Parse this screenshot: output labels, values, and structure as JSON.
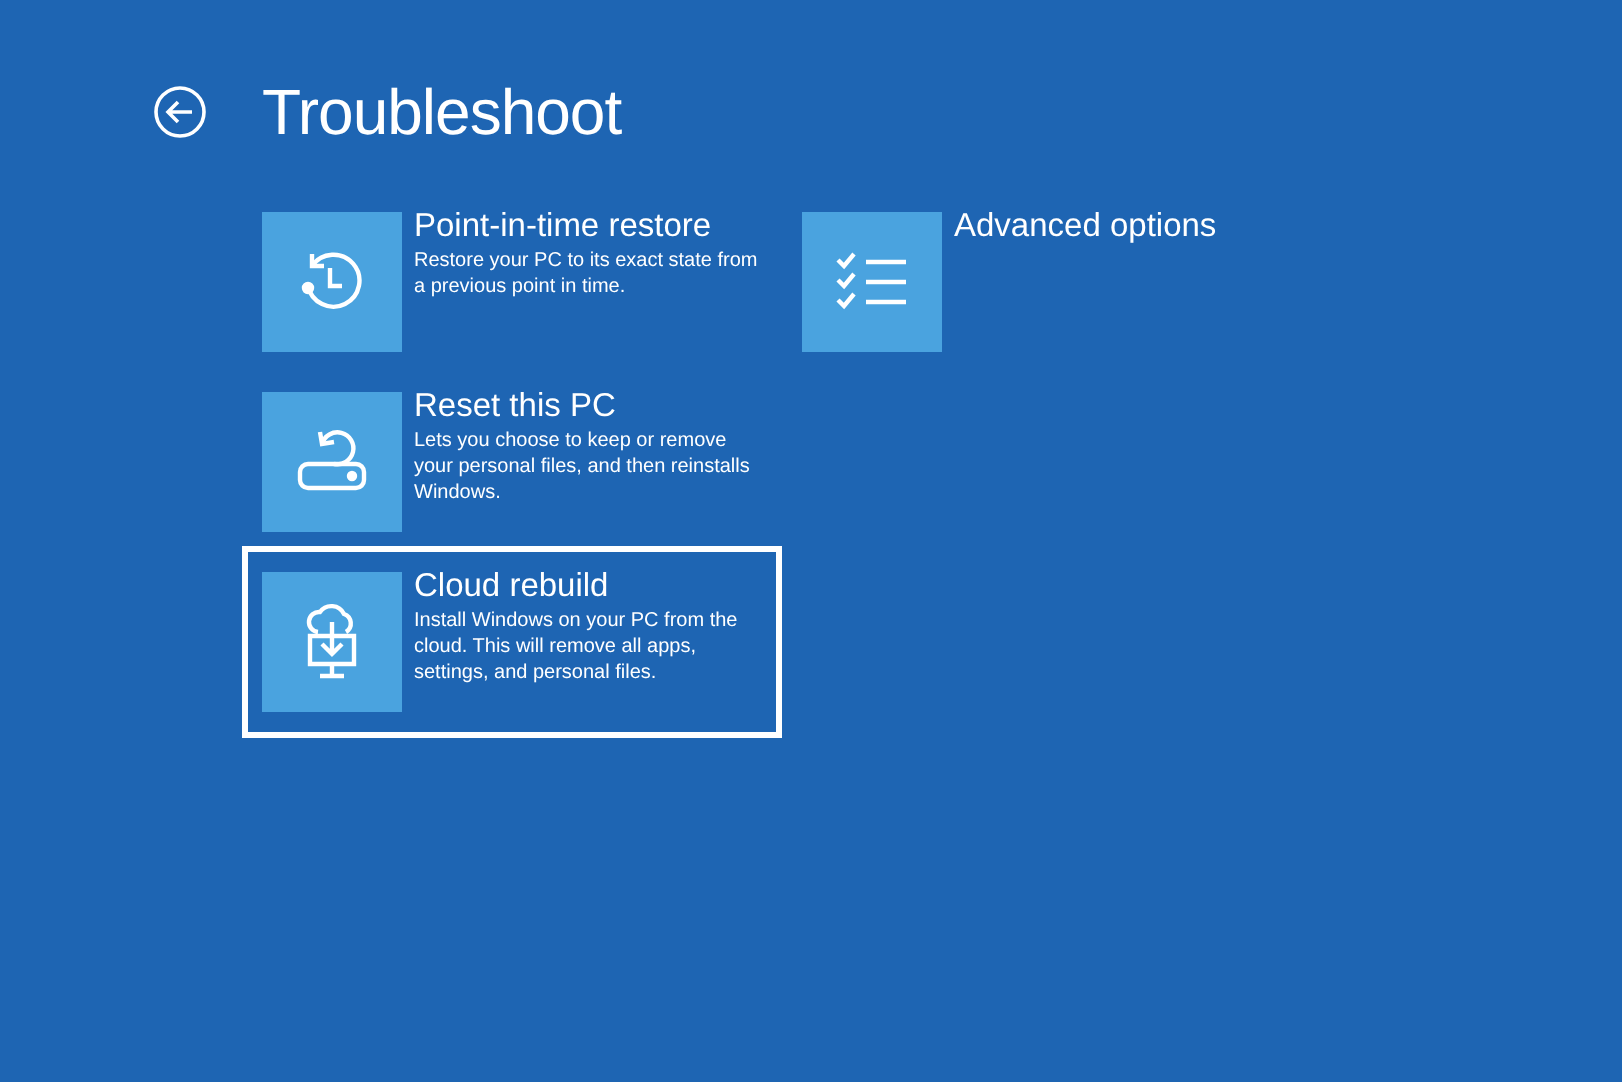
{
  "header": {
    "title": "Troubleshoot"
  },
  "columns": [
    [
      {
        "title": "Point-in-time restore",
        "description": "Restore your PC to its exact state from a previous point in time.",
        "selected": false
      },
      {
        "title": "Reset this PC",
        "description": "Lets you choose to keep or remove your personal files, and then reinstalls Windows.",
        "selected": false
      },
      {
        "title": "Cloud rebuild",
        "description": "Install Windows on your PC from the cloud. This will remove all apps, settings, and personal files.",
        "selected": true
      }
    ],
    [
      {
        "title": "Advanced options",
        "selected": false
      }
    ]
  ]
}
